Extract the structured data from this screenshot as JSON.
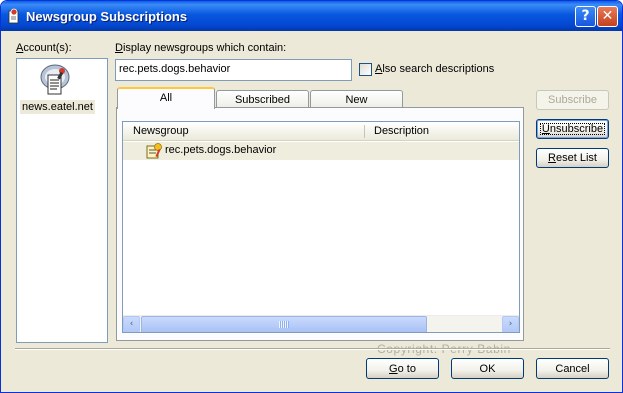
{
  "window": {
    "title": "Newsgroup Subscriptions",
    "help_glyph": "?",
    "close_glyph": "✕"
  },
  "accounts": {
    "label": "Account(s):",
    "label_mnemonic": "A",
    "label_rest": "ccount(s):",
    "items": [
      {
        "name": "news.eatel.net",
        "icon": "news-server-icon"
      }
    ]
  },
  "filter": {
    "label_mnemonic": "D",
    "label_rest": "isplay newsgroups which contain:",
    "value": "rec.pets.dogs.behavior",
    "also_search_mnemonic": "A",
    "also_search_rest": "lso search descriptions",
    "also_search_checked": false
  },
  "tabs": [
    {
      "label": "All",
      "active": true
    },
    {
      "label": "Subscribed",
      "active": false
    },
    {
      "label": "New",
      "active": false
    }
  ],
  "list": {
    "columns": [
      "Newsgroup",
      "Description"
    ],
    "rows": [
      {
        "newsgroup": "rec.pets.dogs.behavior",
        "description": "",
        "icon": "subscribed-newsgroup-icon",
        "selected": true
      }
    ],
    "scroll_left_glyph": "‹",
    "scroll_right_glyph": "›"
  },
  "side_buttons": {
    "subscribe": {
      "label": "Subscribe",
      "enabled": false
    },
    "unsubscribe": {
      "mnemonic": "U",
      "rest": "nsubscribe",
      "enabled": true,
      "focused": true
    },
    "reset_list": {
      "mnemonic": "R",
      "rest": "eset List",
      "enabled": true
    }
  },
  "footer": {
    "watermark": "Copyright: Perry Babin",
    "goto": {
      "mnemonic": "G",
      "rest": "o to"
    },
    "ok": "OK",
    "cancel": "Cancel"
  },
  "colors": {
    "titlebar": "#0858E0",
    "dialog_bg": "#ECE9D8",
    "tab_accent": "#FFC83C",
    "border": "#7F9DB9"
  }
}
